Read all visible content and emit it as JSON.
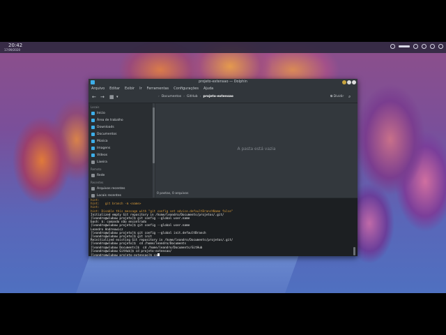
{
  "topbar": {
    "time": "20:42",
    "date": "17/09/2020"
  },
  "window": {
    "title": "projeto-extensao — Dolphin",
    "menu": [
      "Arquivo",
      "Editar",
      "Exibir",
      "Ir",
      "Ferramentas",
      "Configurações",
      "Ajuda"
    ],
    "breadcrumbs": [
      "Documentos",
      "GitHub",
      "projeto-extensao"
    ],
    "split_label": "Dividir",
    "empty_message": "A pasta está vazia",
    "status": "0 pastas, 0 arquivos"
  },
  "sidebar": {
    "sections": [
      {
        "header": "Locais",
        "items": [
          {
            "label": "Início",
            "color": "#3daee9"
          },
          {
            "label": "Área de trabalho",
            "color": "#3daee9"
          },
          {
            "label": "Downloads",
            "color": "#3daee9"
          },
          {
            "label": "Documentos",
            "color": "#3daee9"
          },
          {
            "label": "Música",
            "color": "#3daee9"
          },
          {
            "label": "Imagens",
            "color": "#3daee9"
          },
          {
            "label": "Vídeos",
            "color": "#3daee9"
          },
          {
            "label": "Lixeira",
            "color": "#8a8f94"
          }
        ]
      },
      {
        "header": "Remoto",
        "items": [
          {
            "label": "Rede",
            "color": "#8a8f94"
          }
        ]
      },
      {
        "header": "Recentes",
        "items": [
          {
            "label": "Arquivos recentes",
            "color": "#8a8f94"
          },
          {
            "label": "Locais recentes",
            "color": "#8a8f94"
          }
        ]
      }
    ]
  },
  "terminal": {
    "lines": [
      {
        "text": "hint:",
        "type": "hint"
      },
      {
        "text": "hint:   git branch -m <name>",
        "type": "hint"
      },
      {
        "text": "hint:",
        "type": "hint"
      },
      {
        "text": "hint: Disable this message with \"git config set advice.defaultBranchName false\"",
        "type": "hint"
      },
      {
        "text": "Initialized empty Git repository in /home/leandro/Documents/projetos/.git/",
        "type": "normal"
      },
      {
        "text": "[leandro@wlubow projeto]$ git config --global user.name",
        "type": "normal"
      },
      {
        "text": "bash: $: comando não encontrado",
        "type": "normal"
      },
      {
        "text": "[leandro@wlubow projeto]$ git config --global user.name",
        "type": "normal"
      },
      {
        "text": "Leandro Andreowicz",
        "type": "normal"
      },
      {
        "text": "[leandro@wlubow projeto]$ git config --global init.defaultBranch",
        "type": "normal"
      },
      {
        "text": "[leandro@wlubow projeto]$ git init",
        "type": "normal"
      },
      {
        "text": "Reinitialized existing Git repository in /home/leandro/Documents/projetos/.git/",
        "type": "normal"
      },
      {
        "text": "[leandro@wlubow projeto]$  cd /home/leandro/Documents",
        "type": "normal"
      },
      {
        "text": "[leandro@wlubow Documents]$  cd /home/leandro/Documents/GitHub",
        "type": "normal"
      },
      {
        "text": "[leandro@wlubow GitHub]$ cd projeto-extensao/",
        "type": "normal"
      },
      {
        "text": "[leandro@wlubow projeto-extensao]$ ca",
        "type": "prompt"
      }
    ]
  }
}
